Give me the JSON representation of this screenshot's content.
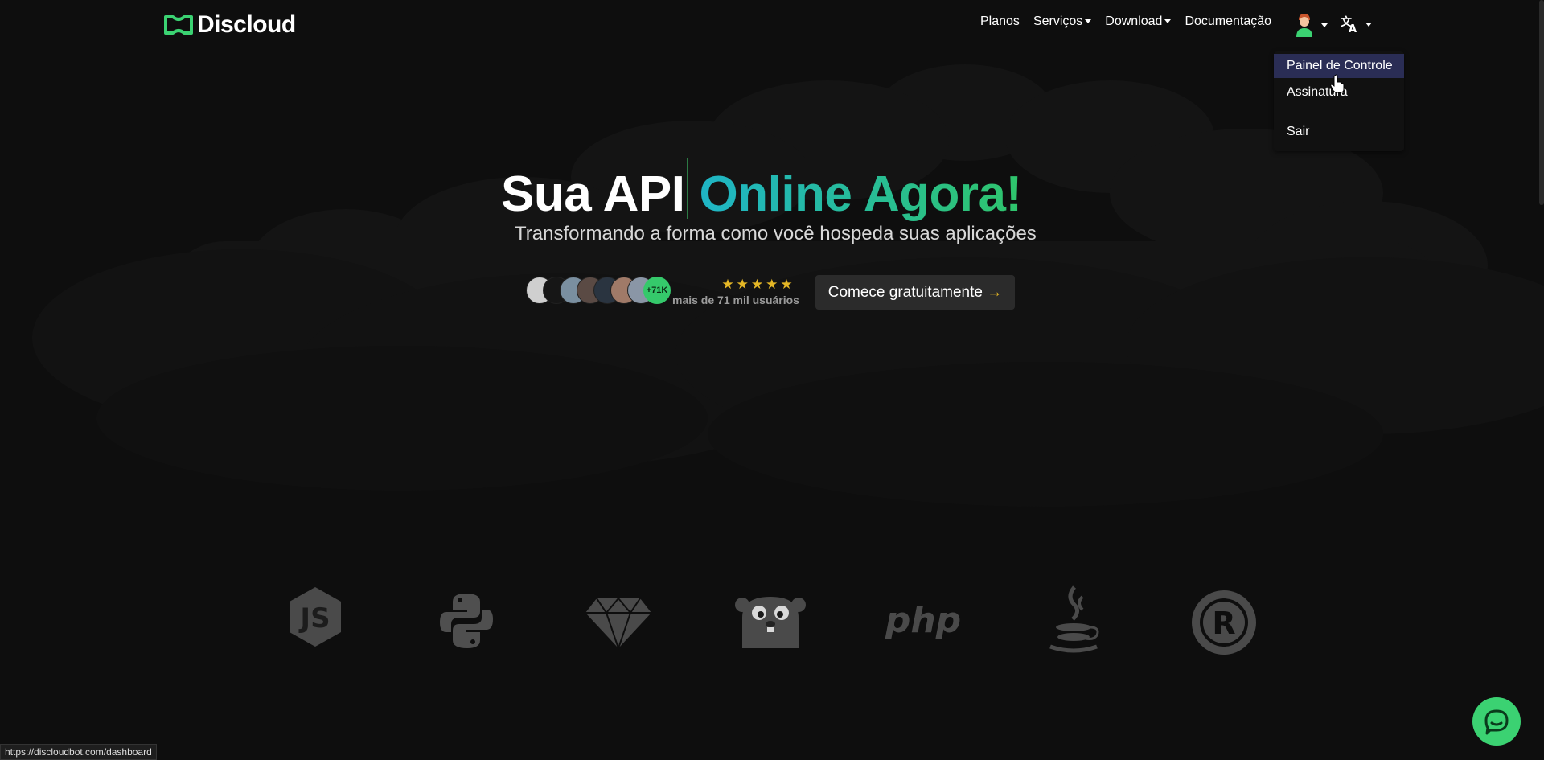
{
  "brand": {
    "name": "Discloud",
    "logo_icon": "discloud-logo-icon",
    "accent": "#3bd272"
  },
  "nav": {
    "links": [
      {
        "label": "Planos",
        "dropdown": false
      },
      {
        "label": "Serviços",
        "dropdown": true
      },
      {
        "label": "Download",
        "dropdown": true
      },
      {
        "label": "Documentação",
        "dropdown": false
      }
    ],
    "user_icon": "user-avatar-icon",
    "language_icon": "translate-icon"
  },
  "user_menu": {
    "items": [
      {
        "label": "Painel de Controle",
        "active": true
      },
      {
        "label": "Assinatura",
        "active": false
      },
      {
        "label": "Sair",
        "active": false
      }
    ]
  },
  "hero": {
    "title_white": "Sua API",
    "title_gradient": "Online Agora!",
    "subtitle": "Transformando a forma como você hospeda suas aplicações",
    "user_count_badge": "+71K",
    "rating_stars": 5,
    "rating_text": "mais de 71 mil usuários",
    "cta_label": "Comece gratuitamente",
    "cta_arrow": "→"
  },
  "technologies": [
    "nodejs-icon",
    "python-icon",
    "ruby-icon",
    "go-icon",
    "php-icon",
    "java-icon",
    "rust-icon"
  ],
  "status_bar": {
    "url": "https://discloudbot.com/dashboard"
  },
  "chat": {
    "icon": "chat-bubble-icon"
  }
}
